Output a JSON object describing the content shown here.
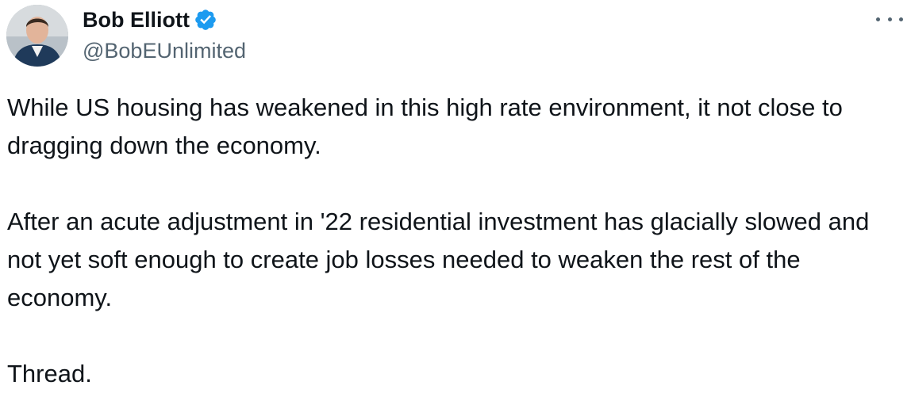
{
  "author": {
    "display_name": "Bob Elliott",
    "handle": "@BobEUnlimited",
    "verified": true,
    "verified_color": "#1d9bf0"
  },
  "menu": {
    "icon": "more-horizontal-icon"
  },
  "tweet": {
    "paragraphs": [
      "While US housing has weakened in this high rate environment, it not close to dragging down the economy.",
      "After an acute adjustment in '22 residential investment has glacially slowed and not yet soft enough to create job losses needed to weaken the rest of the economy.",
      "Thread."
    ]
  },
  "colors": {
    "text_primary": "#0f1419",
    "text_secondary": "#536471",
    "accent": "#1d9bf0"
  }
}
